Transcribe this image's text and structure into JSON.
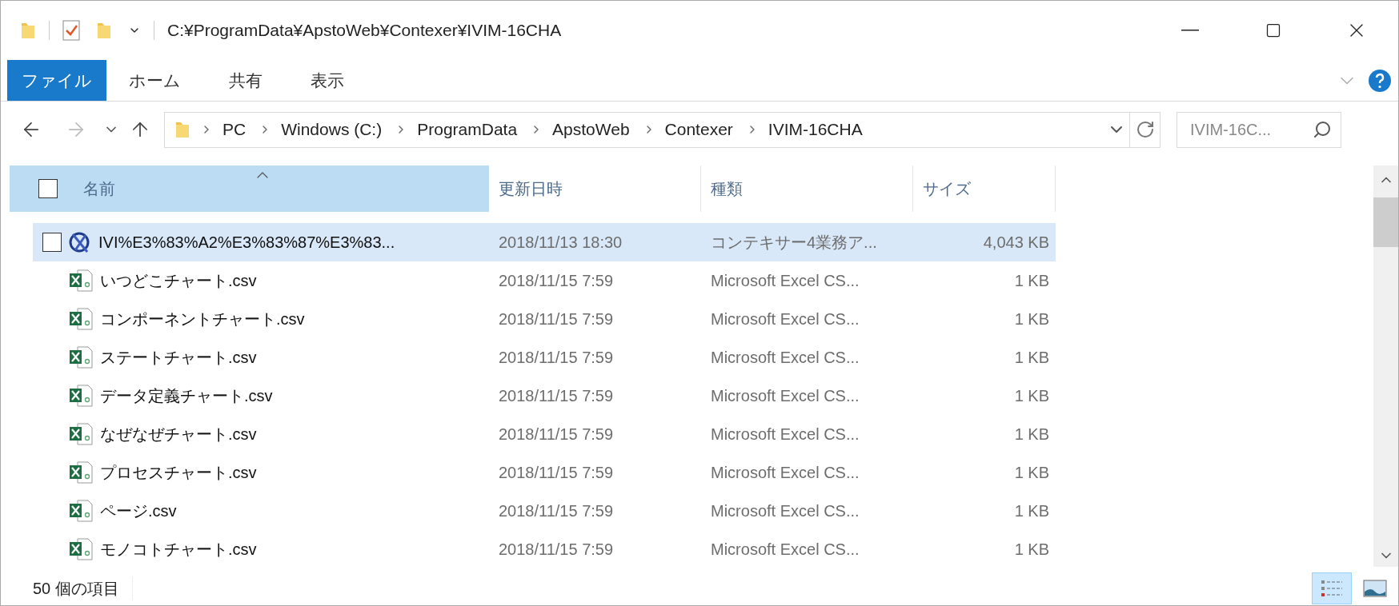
{
  "window": {
    "title": "C:¥ProgramData¥ApstoWeb¥Contexer¥IVIM-16CHA"
  },
  "ribbon_tabs": [
    {
      "label": "ファイル",
      "kind": "file"
    },
    {
      "label": "ホーム",
      "kind": "tab"
    },
    {
      "label": "共有",
      "kind": "tab"
    },
    {
      "label": "表示",
      "kind": "tab"
    }
  ],
  "breadcrumb": [
    "PC",
    "Windows (C:)",
    "ProgramData",
    "ApstoWeb",
    "Contexer",
    "IVIM-16CHA"
  ],
  "search": {
    "placeholder": "IVIM-16C..."
  },
  "table": {
    "select_all": {
      "checked": false
    },
    "columns": [
      {
        "label": "名前",
        "sorted": true
      },
      {
        "label": "更新日時",
        "sorted": false
      },
      {
        "label": "種類",
        "sorted": false
      },
      {
        "label": "サイズ",
        "sorted": false
      }
    ],
    "rows": [
      {
        "kind": "app",
        "selected": true,
        "checked": false,
        "name": "IVI%E3%83%A2%E3%83%87%E3%83...",
        "date": "2018/11/13 18:30",
        "type": "コンテキサー4業務ア...",
        "size": "4,043 KB"
      },
      {
        "kind": "excel",
        "selected": false,
        "name": "いつどこチャート.csv",
        "date": "2018/11/15 7:59",
        "type": "Microsoft Excel CS...",
        "size": "1 KB"
      },
      {
        "kind": "excel",
        "selected": false,
        "name": "コンポーネントチャート.csv",
        "date": "2018/11/15 7:59",
        "type": "Microsoft Excel CS...",
        "size": "1 KB"
      },
      {
        "kind": "excel",
        "selected": false,
        "name": "ステートチャート.csv",
        "date": "2018/11/15 7:59",
        "type": "Microsoft Excel CS...",
        "size": "1 KB"
      },
      {
        "kind": "excel",
        "selected": false,
        "name": "データ定義チャート.csv",
        "date": "2018/11/15 7:59",
        "type": "Microsoft Excel CS...",
        "size": "1 KB"
      },
      {
        "kind": "excel",
        "selected": false,
        "name": "なぜなぜチャート.csv",
        "date": "2018/11/15 7:59",
        "type": "Microsoft Excel CS...",
        "size": "1 KB"
      },
      {
        "kind": "excel",
        "selected": false,
        "name": "プロセスチャート.csv",
        "date": "2018/11/15 7:59",
        "type": "Microsoft Excel CS...",
        "size": "1 KB"
      },
      {
        "kind": "excel",
        "selected": false,
        "name": "ページ.csv",
        "date": "2018/11/15 7:59",
        "type": "Microsoft Excel CS...",
        "size": "1 KB"
      },
      {
        "kind": "excel",
        "selected": false,
        "name": "モノコトチャート.csv",
        "date": "2018/11/15 7:59",
        "type": "Microsoft Excel CS...",
        "size": "1 KB"
      }
    ]
  },
  "status_bar": {
    "count": "50 個の項目",
    "views": [
      {
        "kind": "details",
        "selected": true
      },
      {
        "kind": "large_icons",
        "selected": false
      }
    ]
  }
}
